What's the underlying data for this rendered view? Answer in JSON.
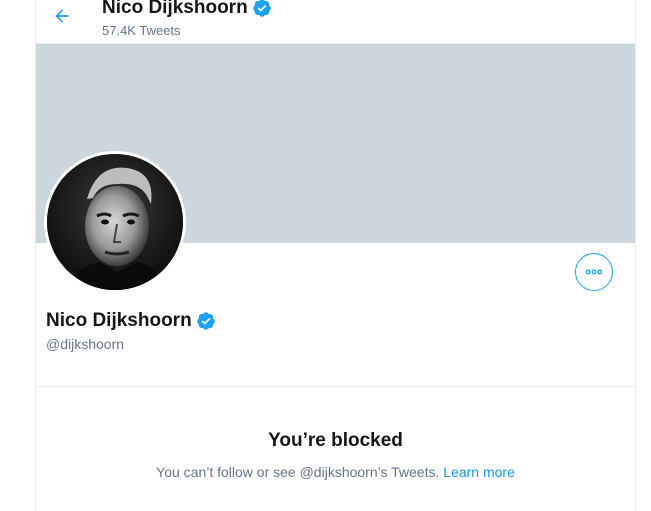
{
  "header": {
    "name": "Nico Dijkshoorn",
    "tweet_count": "57.4K Tweets",
    "icons": {
      "back": "arrow-left-icon",
      "verified": "verified-badge-icon"
    }
  },
  "profile": {
    "name": "Nico Dijkshoorn",
    "handle": "@dijkshoorn",
    "banner_color": "#ccd6dd",
    "avatar_alt": "profile photo",
    "more_icon": "more-horizontal-icon"
  },
  "blocked": {
    "title": "You’re blocked",
    "message": "You can’t follow or see @dijkshoorn’s Tweets.",
    "link": "Learn more"
  },
  "colors": {
    "accent": "#1da1f2",
    "link": "#1b95e0",
    "text_primary": "#14171a",
    "text_secondary": "#657786"
  }
}
